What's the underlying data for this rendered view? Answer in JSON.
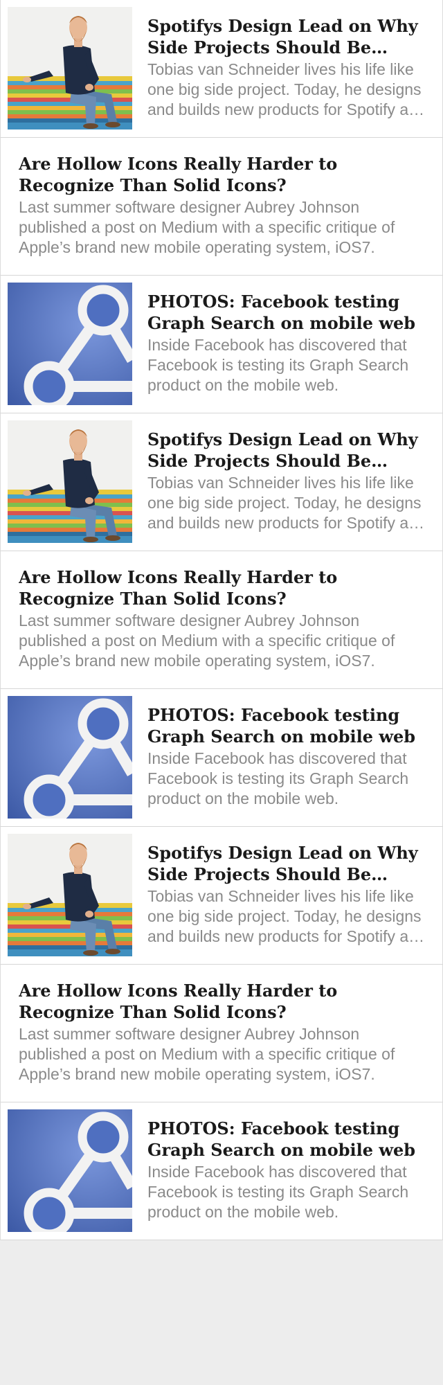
{
  "colors": {
    "page_background": "#ededed",
    "card_background": "#ffffff",
    "title_text": "#1a1a1a",
    "excerpt_text": "#8a8a8a",
    "facebook_blue": "#4f6fc0"
  },
  "articles": [
    {
      "type": "portrait",
      "thumbnail": "man-on-bench-photo",
      "title": "Spotifys Design Lead on Why Side Projects Should Be Stupid",
      "excerpt": "Tobias van Schneider lives his life like one big side project. Today, he designs and builds new products for Spotify and runs several side projects."
    },
    {
      "type": "text",
      "title": "Are Hollow Icons Really Harder to Recognize Than Solid Icons?",
      "excerpt": "Last summer software designer Aubrey Johnson published a post on Medium with a specific critique of Apple’s brand new mobile operating system, iOS7."
    },
    {
      "type": "facebook",
      "thumbnail": "graph-search-icon",
      "title": "PHOTOS: Facebook testing Graph Search on mobile web",
      "excerpt": "Inside Facebook has discovered that Facebook is testing its Graph Search product on the mobile web."
    },
    {
      "type": "portrait",
      "thumbnail": "man-on-bench-photo",
      "title": "Spotifys Design Lead on Why Side Projects Should Be Stupid",
      "excerpt": "Tobias van Schneider lives his life like one big side project. Today, he designs and builds new products for Spotify and runs several side projects."
    },
    {
      "type": "text",
      "title": "Are Hollow Icons Really Harder to Recognize Than Solid Icons?",
      "excerpt": "Last summer software designer Aubrey Johnson published a post on Medium with a specific critique of Apple’s brand new mobile operating system, iOS7."
    },
    {
      "type": "facebook",
      "thumbnail": "graph-search-icon",
      "title": "PHOTOS: Facebook testing Graph Search on mobile web",
      "excerpt": "Inside Facebook has discovered that Facebook is testing its Graph Search product on the mobile web."
    },
    {
      "type": "portrait",
      "thumbnail": "man-on-bench-photo",
      "title": "Spotifys Design Lead on Why Side Projects Should Be Stupid",
      "excerpt": "Tobias van Schneider lives his life like one big side project. Today, he designs and builds new products for Spotify and runs several side projects."
    },
    {
      "type": "text",
      "title": "Are Hollow Icons Really Harder to Recognize Than Solid Icons?",
      "excerpt": "Last summer software designer Aubrey Johnson published a post on Medium with a specific critique of Apple’s brand new mobile operating system, iOS7."
    },
    {
      "type": "facebook",
      "thumbnail": "graph-search-icon",
      "title": "PHOTOS: Facebook testing Graph Search on mobile web",
      "excerpt": "Inside Facebook has discovered that Facebook is testing its Graph Search product on the mobile web."
    }
  ]
}
